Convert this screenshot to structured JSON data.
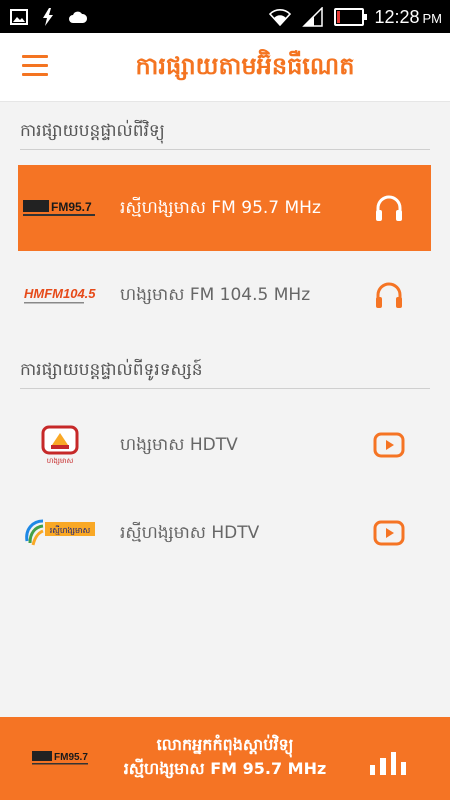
{
  "status": {
    "time": "12:28",
    "ampm": "PM"
  },
  "header": {
    "title": "ការផ្សាយតាមអ៊ិនធឺណេត"
  },
  "sections": [
    {
      "title": "ការផ្សាយបន្តផ្ទាល់ពីវិទ្យុ",
      "items": [
        {
          "label": "រស្មីហង្សមាស FM 95.7 MHz",
          "logo_text": "FM95.7",
          "action_icon": "headphones-icon",
          "active": true
        },
        {
          "label": "ហង្សមាស FM 104.5 MHz",
          "logo_text": "HMFM104.5",
          "action_icon": "headphones-icon",
          "active": false
        }
      ]
    },
    {
      "title": "ការផ្សាយបន្តផ្ទាល់ពីទូរទស្សន៍",
      "items": [
        {
          "label": "ហង្សមាស HDTV",
          "logo_text": "ហង្សមាស",
          "action_icon": "play-icon",
          "active": false
        },
        {
          "label": "រស្មីហង្សមាស HDTV",
          "logo_text": "រស្មីហង្សមាស",
          "action_icon": "play-icon",
          "active": false
        }
      ]
    }
  ],
  "player": {
    "line1": "លោកអ្នកកំពុងស្តាប់វិទ្យុ",
    "line2": "រស្មីហង្សមាស FM 95.7 MHz",
    "logo_text": "FM95.7"
  },
  "colors": {
    "accent": "#f57424",
    "text_gray": "#666666",
    "background": "#f3f3f3"
  }
}
